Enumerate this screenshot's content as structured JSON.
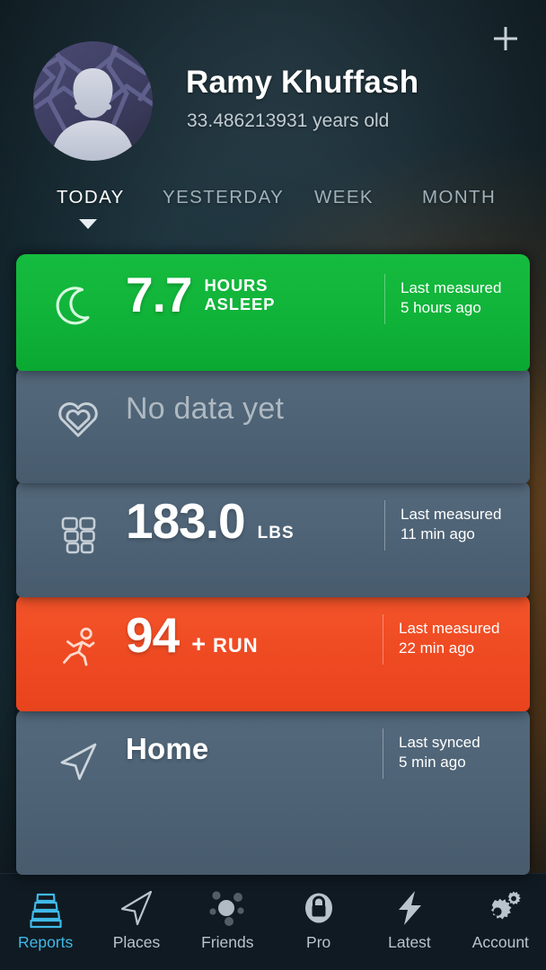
{
  "header": {
    "add_button_label": "+",
    "add_button_icon": "plus-icon",
    "avatar_icon": "default-user-avatar",
    "user_name": "Ramy Khuffash",
    "user_age": "33.486213931 years old"
  },
  "period_tabs": {
    "active_index": 0,
    "items": [
      {
        "label": "TODAY",
        "active": true
      },
      {
        "label": "YESTERDAY",
        "active": false
      },
      {
        "label": "WEEK",
        "active": false
      },
      {
        "label": "MONTH",
        "active": false
      }
    ]
  },
  "cards": [
    {
      "id": "sleep",
      "icon": "moon-icon",
      "color": "#11b53a",
      "value": "7.7",
      "unit_line1": "HOURS",
      "unit_line2": "ASLEEP",
      "meta_line1": "Last measured",
      "meta_line2": "5 hours ago"
    },
    {
      "id": "heart",
      "icon": "heart-icon",
      "color": "#4e6376",
      "empty_text": "No data yet"
    },
    {
      "id": "weight",
      "icon": "scale-grid-icon",
      "color": "#4e6376",
      "value": "183.0",
      "unit": "LBS",
      "meta_line1": "Last measured",
      "meta_line2": "11 min ago"
    },
    {
      "id": "activity",
      "icon": "running-person-icon",
      "color": "#ef4b23",
      "value": "94",
      "plus": "+",
      "unit": "RUN",
      "meta_line1": "Last measured",
      "meta_line2": "22 min ago"
    },
    {
      "id": "location",
      "icon": "navigation-arrow-icon",
      "color": "#4e6376",
      "place": "Home",
      "meta_line1": "Last synced",
      "meta_line2": "5 min ago"
    }
  ],
  "bottom_nav": {
    "active_index": 0,
    "active_color": "#3fb9e8",
    "items": [
      {
        "label": "Reports",
        "icon": "stacked-layers-icon",
        "active": true
      },
      {
        "label": "Places",
        "icon": "navigation-arrow-icon",
        "active": false
      },
      {
        "label": "Friends",
        "icon": "social-dots-icon",
        "active": false
      },
      {
        "label": "Pro",
        "icon": "lock-icon",
        "active": false
      },
      {
        "label": "Latest",
        "icon": "lightning-bolt-icon",
        "active": false
      },
      {
        "label": "Account",
        "icon": "gears-icon",
        "active": false
      }
    ]
  }
}
